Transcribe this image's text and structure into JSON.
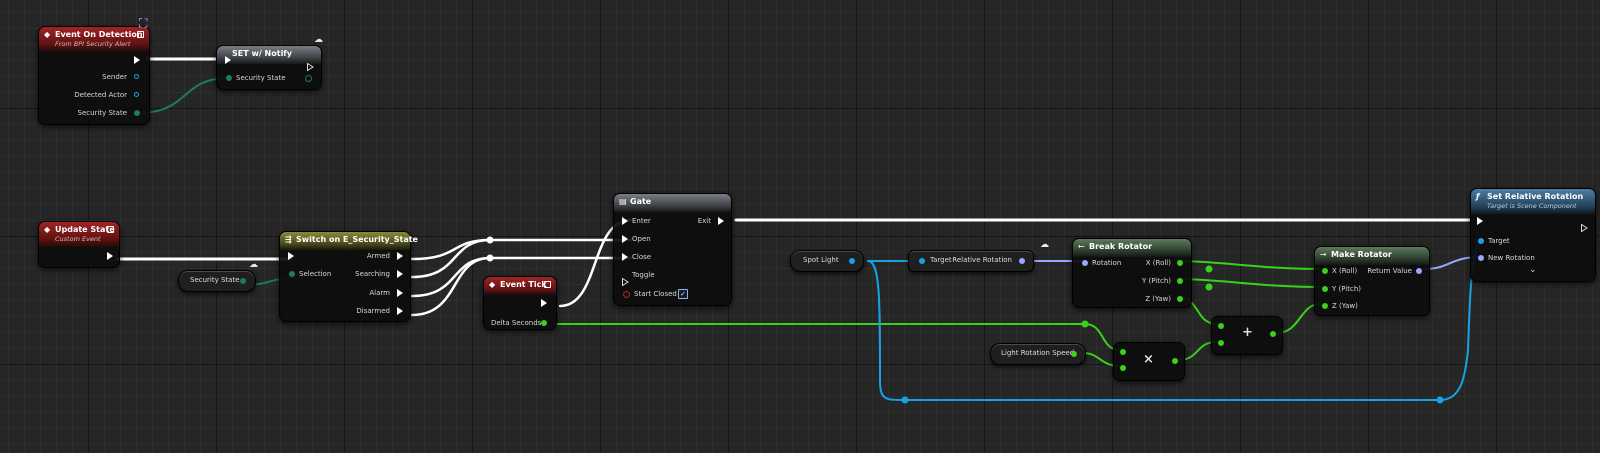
{
  "nodes": {
    "event_on_detection": {
      "title": "Event On Detection",
      "subtitle": "From BPI Security Alert",
      "pins": {
        "sender": "Sender",
        "detected_actor": "Detected Actor",
        "security_state": "Security State"
      }
    },
    "set_notify": {
      "title": "SET w/ Notify",
      "pins": {
        "security_state": "Security State"
      }
    },
    "update_state": {
      "title": "Update State",
      "subtitle": "Custom Event"
    },
    "security_state_var": {
      "label": "Security State"
    },
    "switch": {
      "title": "Switch on E_Security_State",
      "pins": {
        "selection": "Selection",
        "armed": "Armed",
        "searching": "Searching",
        "alarm": "Alarm",
        "disarmed": "Disarmed"
      }
    },
    "event_tick": {
      "title": "Event Tick",
      "pins": {
        "delta_seconds": "Delta Seconds"
      }
    },
    "gate": {
      "title": "Gate",
      "pins": {
        "enter": "Enter",
        "open": "Open",
        "close": "Close",
        "toggle": "Toggle",
        "start_closed": "Start Closed",
        "exit": "Exit"
      }
    },
    "spot_light_var": {
      "label": "Spot Light"
    },
    "get_relative_rotation": {
      "pins": {
        "target": "Target",
        "relative_rotation": "Relative Rotation"
      }
    },
    "break_rotator": {
      "title": "Break Rotator",
      "pins": {
        "rotation": "Rotation",
        "x": "X (Roll)",
        "y": "Y (Pitch)",
        "z": "Z (Yaw)"
      }
    },
    "light_rotation_speed_var": {
      "label": "Light Rotation Speed"
    },
    "multiply": {
      "symbol": "×"
    },
    "add": {
      "symbol": "+"
    },
    "make_rotator": {
      "title": "Make Rotator",
      "pins": {
        "x": "X (Roll)",
        "y": "Y (Pitch)",
        "z": "Z (Yaw)",
        "return_value": "Return Value"
      }
    },
    "set_relative_rotation": {
      "title": "Set Relative Rotation",
      "subtitle": "Target is Scene Component",
      "pins": {
        "target": "Target",
        "new_rotation": "New Rotation"
      },
      "expand": "⌄"
    }
  },
  "icons": {
    "event": "diamond-icon",
    "function": "function-f-icon",
    "switch": "switch-icon",
    "gate": "gate-icon",
    "break": "break-struct-icon",
    "make": "make-struct-icon",
    "network": "replication-cloud-icon"
  },
  "colors": {
    "exec": "#ffffff",
    "float": "#3ad11c",
    "object": "#16a3e6",
    "enum": "#1c7a66",
    "rotator": "#9aa6ff"
  }
}
